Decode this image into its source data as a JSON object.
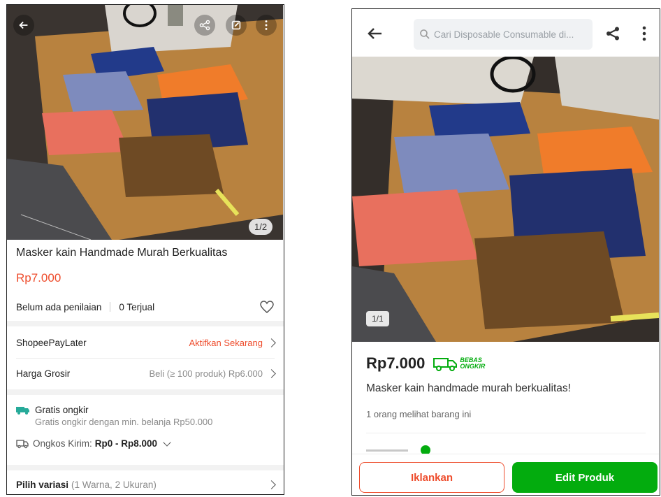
{
  "left": {
    "photo_counter": "1/2",
    "title": "Masker kain Handmade Murah Berkualitas",
    "price": "Rp7.000",
    "rating_text": "Belum ada penilaian",
    "sold_text": "0 Terjual",
    "paylater": {
      "label": "ShopeePayLater",
      "action": "Aktifkan Sekarang"
    },
    "grosir": {
      "label": "Harga Grosir",
      "value": "Beli (≥ 100 produk) Rp6.000"
    },
    "shipping": {
      "free_title": "Gratis ongkir",
      "free_sub": "Gratis ongkir dengan min. belanja Rp50.000",
      "cost_label": "Ongkos Kirim:",
      "cost_value": "Rp0 - Rp8.000"
    },
    "variant": {
      "label": "Pilih variasi",
      "detail": "(1 Warna, 2 Ukuran)"
    },
    "colors": {
      "price": "#ee4d2d",
      "action": "#ee4d2d"
    }
  },
  "right": {
    "search_placeholder": "Cari Disposable Consumable di...",
    "photo_counter": "1/1",
    "price": "Rp7.000",
    "badge_top": "BEBAS",
    "badge_bottom": "ONGKIR",
    "title": "Masker kain handmade murah berkualitas!",
    "viewers": "1 orang melihat barang ini",
    "advertise_button": "Iklankan",
    "edit_button": "Edit Produk",
    "colors": {
      "green": "#03ac0e",
      "orange": "#ee4d2d"
    }
  }
}
